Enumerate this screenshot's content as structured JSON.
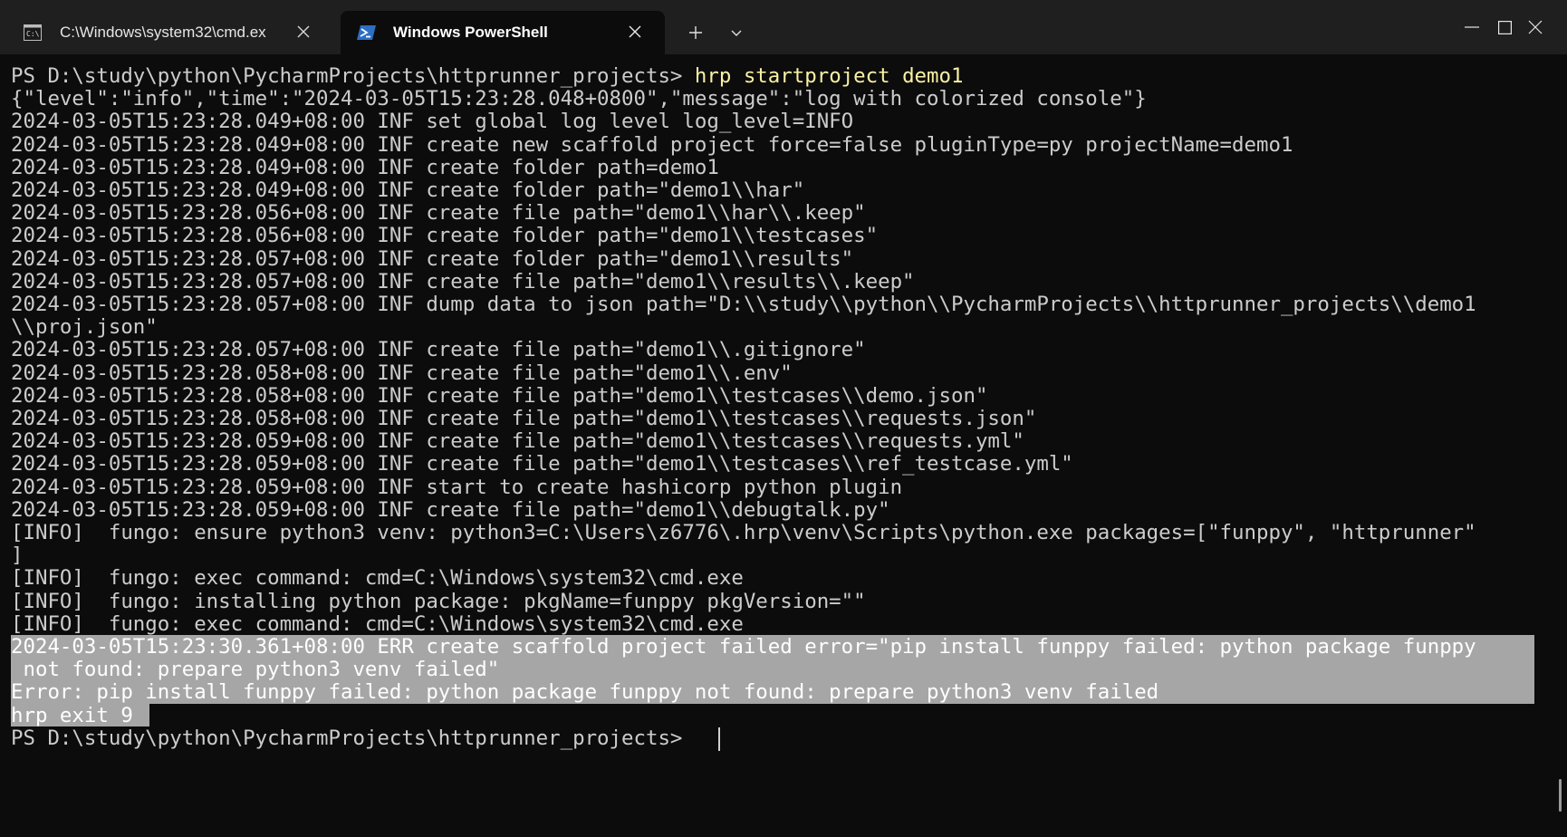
{
  "tabs": [
    {
      "title": "C:\\Windows\\system32\\cmd.ex",
      "icon": "cmd-icon",
      "active": false
    },
    {
      "title": "Windows PowerShell",
      "icon": "powershell-icon",
      "active": true
    }
  ],
  "terminal": {
    "prompt": "PS D:\\study\\python\\PycharmProjects\\httprunner_projects> ",
    "command": "hrp startproject demo1",
    "lines": [
      "{\"level\":\"info\",\"time\":\"2024-03-05T15:23:28.048+0800\",\"message\":\"log with colorized console\"}",
      "2024-03-05T15:23:28.049+08:00 INF set global log level log_level=INFO",
      "2024-03-05T15:23:28.049+08:00 INF create new scaffold project force=false pluginType=py projectName=demo1",
      "2024-03-05T15:23:28.049+08:00 INF create folder path=demo1",
      "2024-03-05T15:23:28.049+08:00 INF create folder path=\"demo1\\\\har\"",
      "2024-03-05T15:23:28.056+08:00 INF create file path=\"demo1\\\\har\\\\.keep\"",
      "2024-03-05T15:23:28.056+08:00 INF create folder path=\"demo1\\\\testcases\"",
      "2024-03-05T15:23:28.057+08:00 INF create folder path=\"demo1\\\\results\"",
      "2024-03-05T15:23:28.057+08:00 INF create file path=\"demo1\\\\results\\\\.keep\"",
      "2024-03-05T15:23:28.057+08:00 INF dump data to json path=\"D:\\\\study\\\\python\\\\PycharmProjects\\\\httprunner_projects\\\\demo1",
      "\\\\proj.json\"",
      "2024-03-05T15:23:28.057+08:00 INF create file path=\"demo1\\\\.gitignore\"",
      "2024-03-05T15:23:28.058+08:00 INF create file path=\"demo1\\\\.env\"",
      "2024-03-05T15:23:28.058+08:00 INF create file path=\"demo1\\\\testcases\\\\demo.json\"",
      "2024-03-05T15:23:28.058+08:00 INF create file path=\"demo1\\\\testcases\\\\requests.json\"",
      "2024-03-05T15:23:28.059+08:00 INF create file path=\"demo1\\\\testcases\\\\requests.yml\"",
      "2024-03-05T15:23:28.059+08:00 INF create file path=\"demo1\\\\testcases\\\\ref_testcase.yml\"",
      "2024-03-05T15:23:28.059+08:00 INF start to create hashicorp python plugin",
      "2024-03-05T15:23:28.059+08:00 INF create file path=\"demo1\\\\debugtalk.py\"",
      "[INFO]  fungo: ensure python3 venv: python3=C:\\Users\\z6776\\.hrp\\venv\\Scripts\\python.exe packages=[\"funppy\", \"httprunner\"",
      "]",
      "[INFO]  fungo: exec command: cmd=C:\\Windows\\system32\\cmd.exe",
      "[INFO]  fungo: installing python package: pkgName=funppy pkgVersion=\"\"",
      "[INFO]  fungo: exec command: cmd=C:\\Windows\\system32\\cmd.exe"
    ],
    "selected_lines": [
      "2024-03-05T15:23:30.361+08:00 ERR create scaffold project failed error=\"pip install funppy failed: python package funppy",
      " not found: prepare python3 venv failed\"",
      "Error: pip install funppy failed: python package funppy not found: prepare python3 venv failed",
      "hrp exit 9"
    ],
    "final_prompt": "PS D:\\study\\python\\PycharmProjects\\httprunner_projects> "
  },
  "colors": {
    "background": "#0c0c0c",
    "text": "#cccccc",
    "command": "#f9f1a5",
    "selection": "#a6a6a6",
    "titlebar": "#1f1f1f"
  }
}
